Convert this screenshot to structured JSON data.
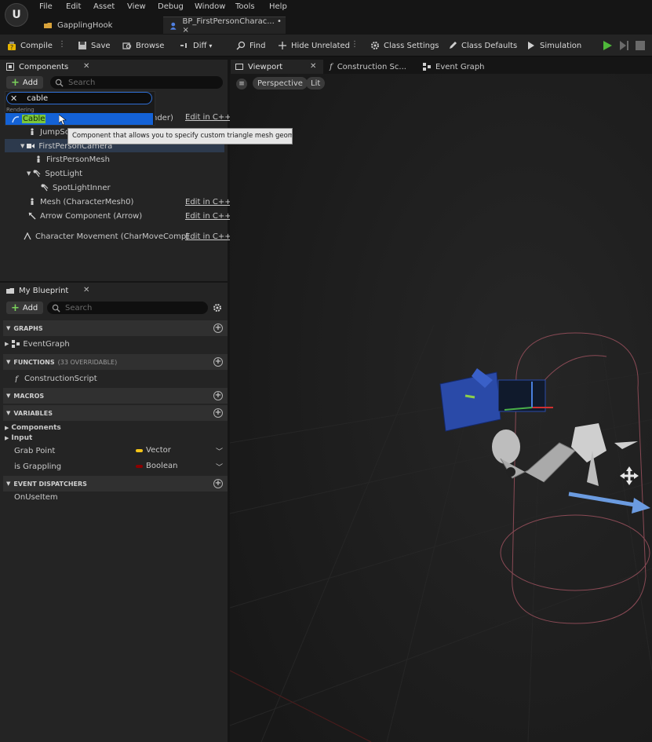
{
  "menu": [
    "File",
    "Edit",
    "Asset",
    "View",
    "Debug",
    "Window",
    "Tools",
    "Help"
  ],
  "logo": "U",
  "doc_tabs": [
    {
      "label": "GapplingHook"
    },
    {
      "label": "BP_FirstPersonCharac... • ×"
    }
  ],
  "toolbar": {
    "compile": "Compile",
    "save": "Save",
    "browse": "Browse",
    "diff": "Diff",
    "find": "Find",
    "hide_unrelated": "Hide Unrelated",
    "class_settings": "Class Settings",
    "class_defaults": "Class Defaults",
    "simulation": "Simulation"
  },
  "components_panel": {
    "title": "Components",
    "add_label": "Add",
    "search_placeholder": "Search",
    "filter_value": "cable",
    "category": "Rendering",
    "highlighted_item": "Cable",
    "tooltip": "Component that allows you to specify custom triangle mesh geometry",
    "partial_row_text": "nder)",
    "items": [
      {
        "label": "JumpScareREF"
      },
      {
        "label": "FirstPersonCamera"
      },
      {
        "label": "FirstPersonMesh"
      },
      {
        "label": "SpotLight"
      },
      {
        "label": "SpotLightInner"
      },
      {
        "label": "Mesh (CharacterMesh0)"
      },
      {
        "label": "Arrow Component (Arrow)"
      },
      {
        "label": "Character Movement (CharMoveComp)"
      }
    ],
    "edit_cpp": "Edit in C++"
  },
  "blueprint_panel": {
    "title": "My Blueprint",
    "add_label": "Add",
    "search_placeholder": "Search",
    "sections": {
      "graphs": "GRAPHS",
      "functions": "FUNCTIONS",
      "functions_note": "(33 OVERRIDABLE)",
      "macros": "MACROS",
      "variables": "VARIABLES",
      "event_dispatchers": "EVENT DISPATCHERS"
    },
    "event_graph": "EventGraph",
    "construction_script": "ConstructionScript",
    "var_groups": [
      "Components",
      "Input"
    ],
    "variables": [
      {
        "name": "Grab Point",
        "type": "Vector",
        "color": "#f5c518"
      },
      {
        "name": "is Grappling",
        "type": "Boolean",
        "color": "#8b0000"
      }
    ],
    "dispatcher": "OnUseItem"
  },
  "editor_tabs": {
    "viewport": "Viewport",
    "construction": "Construction Sc...",
    "event_graph": "Event Graph"
  },
  "viewport": {
    "perspective": "Perspective",
    "lit": "Lit"
  }
}
